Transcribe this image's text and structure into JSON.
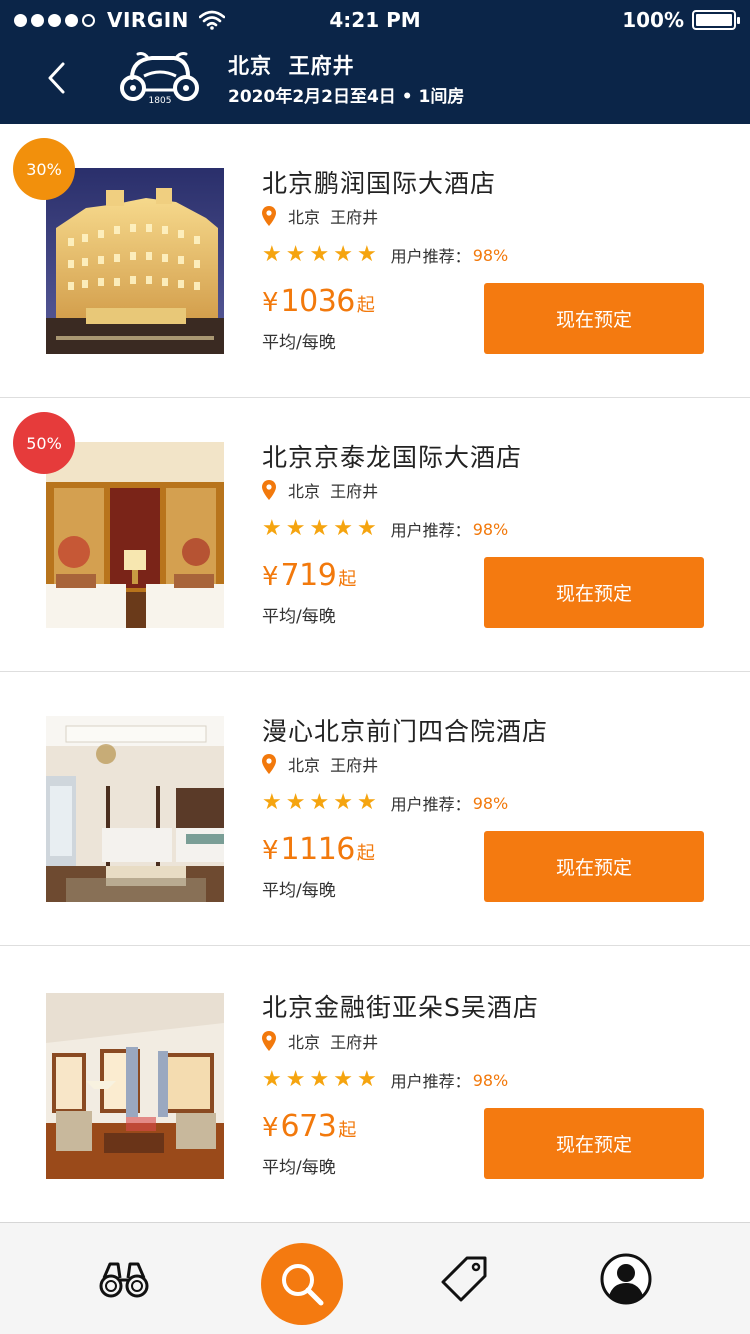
{
  "status_bar": {
    "carrier": "VIRGIN",
    "time": "4:21 PM",
    "battery": "100%"
  },
  "nav": {
    "title": "北京  王府井",
    "subtitle": "2020年2月2日至4日 • 1间房",
    "logo_text": "1805"
  },
  "hotels": [
    {
      "name": "北京鹏润国际大酒店",
      "discount": "30%",
      "discount_color": "#f2900c",
      "location": "北京  王府井",
      "rec_label": "用户推荐：",
      "rec_value": "98%",
      "currency": "¥",
      "price": "1036",
      "price_suffix": "起",
      "per_night": "平均/每晚",
      "book_label": "现在预定",
      "photo": "hotel-exterior-night"
    },
    {
      "name": "北京京泰龙国际大酒店",
      "discount": "50%",
      "discount_color": "#e63b3b",
      "location": "北京  王府井",
      "rec_label": "用户推荐：",
      "rec_value": "98%",
      "currency": "¥",
      "price": "719",
      "price_suffix": "起",
      "per_night": "平均/每晚",
      "book_label": "现在预定",
      "photo": "bedroom-gold-wall"
    },
    {
      "name": "漫心北京前门四合院酒店",
      "discount": "",
      "discount_color": "",
      "location": "北京  王府井",
      "rec_label": "用户推荐：",
      "rec_value": "98%",
      "currency": "¥",
      "price": "1116",
      "price_suffix": "起",
      "per_night": "平均/每晚",
      "book_label": "现在预定",
      "photo": "bedroom-four-poster"
    },
    {
      "name": "北京金融街亚朵S吴酒店",
      "discount": "",
      "discount_color": "",
      "location": "北京  王府井",
      "rec_label": "用户推荐：",
      "rec_value": "98%",
      "currency": "¥",
      "price": "673",
      "price_suffix": "起",
      "per_night": "平均/每晚",
      "book_label": "现在预定",
      "photo": "living-room-wood"
    }
  ],
  "rating_stars": 5,
  "tabbar": {
    "items": [
      "binoculars-icon",
      "search-icon",
      "tag-icon",
      "profile-icon"
    ],
    "active": "search-icon"
  },
  "colors": {
    "header_bg": "#0b2548",
    "accent": "#f47a10",
    "star": "#f5a40f"
  }
}
